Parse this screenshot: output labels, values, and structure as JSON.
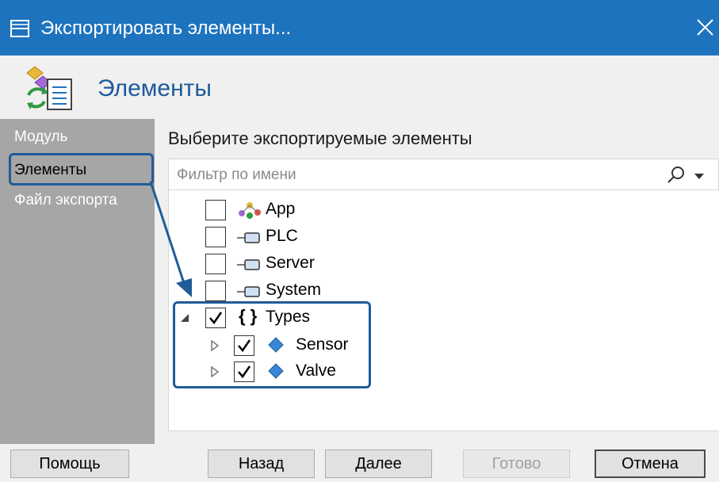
{
  "window": {
    "title": "Экспортировать элементы...",
    "close_glyph": "✕",
    "titlebar_color": "#1e73be"
  },
  "header": {
    "title": "Элементы",
    "icon": "export-elements-icon"
  },
  "sidebar": {
    "items": [
      {
        "label": "Модуль",
        "active": false
      },
      {
        "label": "Элементы",
        "active": true
      },
      {
        "label": "Файл экспорта",
        "active": false
      }
    ]
  },
  "main": {
    "title": "Выберите экспортируемые элементы",
    "filter_placeholder": "Фильтр по имени"
  },
  "tree": [
    {
      "label": "App",
      "checked": false,
      "icon": "app-icon"
    },
    {
      "label": "PLC",
      "checked": false,
      "icon": "connection-icon"
    },
    {
      "label": "Server",
      "checked": false,
      "icon": "connection-icon"
    },
    {
      "label": "System",
      "checked": false,
      "icon": "connection-icon"
    },
    {
      "label": "Types",
      "checked": true,
      "icon": "braces-icon",
      "expanded": true
    },
    {
      "label": "Sensor",
      "checked": true,
      "icon": "diamond-icon",
      "expanded": false
    },
    {
      "label": "Valve",
      "checked": true,
      "icon": "diamond-icon",
      "expanded": false
    }
  ],
  "buttons": {
    "help": "Помощь",
    "back": "Назад",
    "next": "Далее",
    "finish": "Готово",
    "cancel": "Отмена"
  },
  "colors": {
    "accent": "#1e73be",
    "highlight": "#1f5c99",
    "sidebar": "#a6a6a6",
    "heading": "#1d5a9c"
  }
}
